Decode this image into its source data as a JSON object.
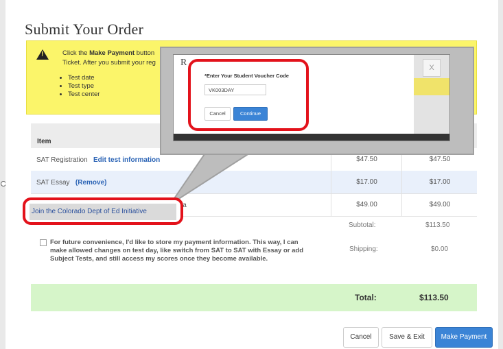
{
  "page": {
    "title": "Submit Your Order"
  },
  "notice": {
    "line1_before": "Click the ",
    "line1_bold": "Make Payment",
    "line1_after": " button",
    "line2": "Ticket. After you submit your reg",
    "bullets": [
      "Test date",
      "Test type",
      "Test center"
    ]
  },
  "table": {
    "header_item": "Item",
    "rows": [
      {
        "label": "SAT Registration",
        "link": "Edit test information",
        "price": "$47.50",
        "total": "$47.50"
      },
      {
        "label": "SAT Essay",
        "link": "(Remove)",
        "price": "$17.00",
        "total": "$17.00"
      },
      {
        "label": "ia",
        "link": "",
        "price": "$49.00",
        "total": "$49.00"
      }
    ]
  },
  "join_initiative": {
    "label": "Join the Colorado Dept of Ed Initiative"
  },
  "summary": {
    "subtotal_label": "Subtotal:",
    "subtotal_value": "$113.50",
    "shipping_label": "Shipping:",
    "shipping_value": "$0.00",
    "total_label": "Total:",
    "total_value": "$113.50"
  },
  "store_payment": {
    "checked": false,
    "text": "For future convenience, I'd like to store my payment information. This way, I can make allowed changes on test day, like switch from SAT to SAT with Essay or add Subject Tests, and still access my scores once they become available."
  },
  "footer": {
    "cancel": "Cancel",
    "save_exit": "Save & Exit",
    "make_payment": "Make Payment"
  },
  "voucher_modal": {
    "peek_r": "R",
    "close": "X",
    "label": "*Enter Your Student Voucher Code",
    "value": "VK003DAY",
    "cancel": "Cancel",
    "continue": "Continue"
  },
  "colors": {
    "accent": "#3b84d6",
    "highlight": "#e3121b",
    "notice": "#fbf56a",
    "total_bar": "#d6f5c9"
  }
}
